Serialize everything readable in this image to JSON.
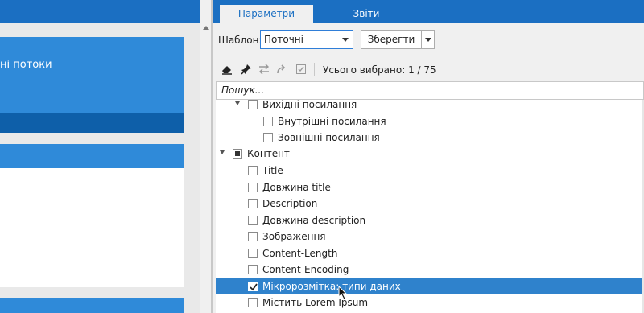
{
  "left_panel": {
    "card_text": "ні потоки"
  },
  "tabs": {
    "active": "Параметри",
    "inactive": "Звіти"
  },
  "template": {
    "label": "Шаблон:",
    "selected": "Поточні",
    "save_label": "Зберегти"
  },
  "toolbar": {
    "icons": [
      "eraser-icon",
      "pin-icon",
      "swap-icon",
      "redo-icon",
      "checkbox-icon"
    ],
    "selected_count": "Усього вибрано: 1 / 75"
  },
  "search": {
    "placeholder": "Пошук..."
  },
  "tree": {
    "items": [
      {
        "label": "Вихідні посилання",
        "state": "unchecked",
        "expanded": true
      },
      {
        "label": "Внутрішні посилання",
        "state": "unchecked"
      },
      {
        "label": "Зовнішні посилання",
        "state": "unchecked"
      },
      {
        "label": "Контент",
        "state": "partial",
        "expanded": true
      },
      {
        "label": "Title",
        "state": "unchecked"
      },
      {
        "label": "Довжина title",
        "state": "unchecked"
      },
      {
        "label": "Description",
        "state": "unchecked"
      },
      {
        "label": "Довжина description",
        "state": "unchecked"
      },
      {
        "label": "Зображення",
        "state": "unchecked"
      },
      {
        "label": "Content-Length",
        "state": "unchecked"
      },
      {
        "label": "Content-Encoding",
        "state": "unchecked"
      },
      {
        "label": "Мікророзмітка: типи даних",
        "state": "checked",
        "selected": true
      },
      {
        "label": "Містить Lorem Ipsum",
        "state": "unchecked"
      }
    ]
  },
  "colors": {
    "accent": "#1b6fc2",
    "selection": "#2f82cc",
    "card_blue": "#2f8ad9"
  }
}
